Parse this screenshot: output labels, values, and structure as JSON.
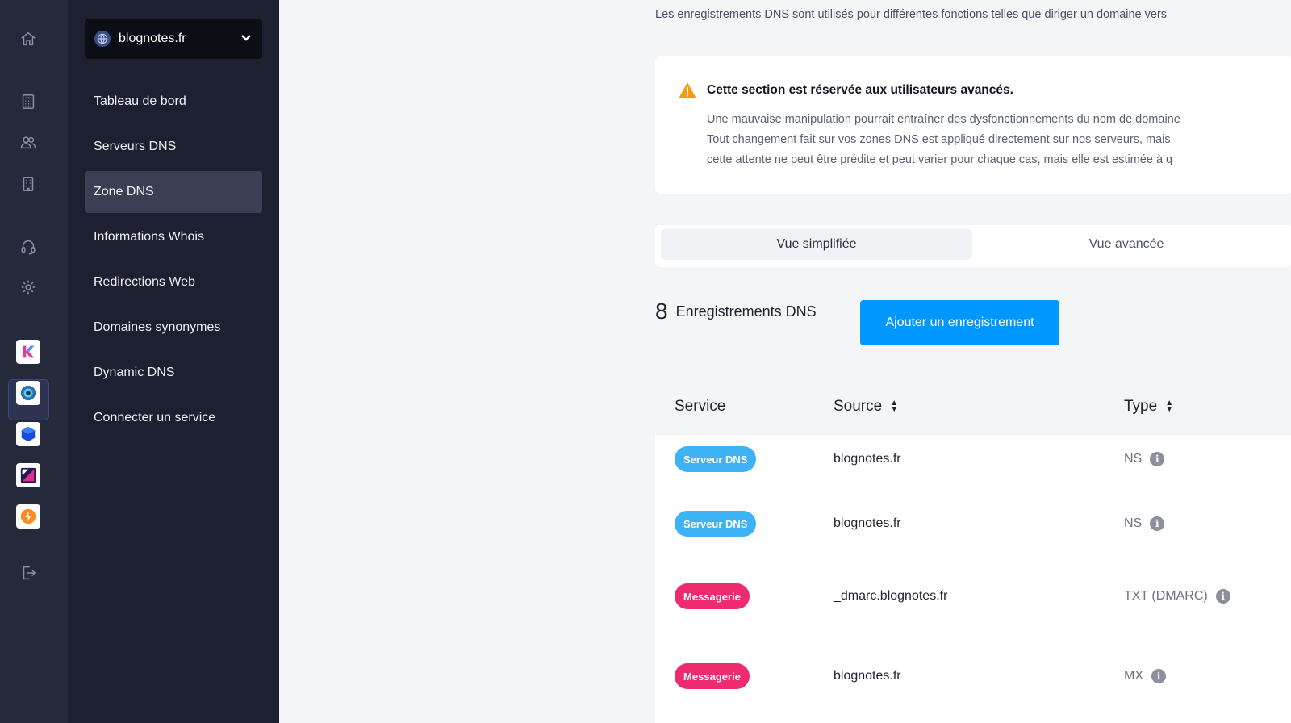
{
  "sidebar": {
    "domain": "blognotes.fr",
    "items": [
      {
        "label": "Tableau de bord"
      },
      {
        "label": "Serveurs DNS"
      },
      {
        "label": "Zone DNS"
      },
      {
        "label": "Informations Whois"
      },
      {
        "label": "Redirections Web"
      },
      {
        "label": "Domaines synonymes"
      },
      {
        "label": "Dynamic DNS"
      },
      {
        "label": "Connecter un service"
      }
    ],
    "active_item": "Zone DNS"
  },
  "rail": {
    "icons": [
      "home-icon",
      "calculator-icon",
      "users-icon",
      "building-icon",
      "headset-icon",
      "settings-icon",
      "logout-icon"
    ],
    "apps": [
      "kchat-app",
      "domains-app",
      "kdrive-app",
      "mail-app",
      "swisstransfer-app"
    ]
  },
  "main": {
    "intro": "Les enregistrements DNS sont utilisés pour différentes fonctions telles que diriger un domaine vers",
    "warning": {
      "title": "Cette section est réservée aux utilisateurs avancés.",
      "lines": [
        "Une mauvaise manipulation pourrait entraîner des dysfonctionnements du nom de domaine",
        "Tout changement fait sur vos zones DNS est appliqué directement sur nos serveurs, mais",
        "cette attente ne peut être prédite et peut varier pour chaque cas, mais elle est estimée à q"
      ]
    },
    "views": {
      "simple": "Vue simplifiée",
      "advanced": "Vue avancée"
    },
    "count": "8",
    "count_label": "Enregistrements DNS",
    "add_button": "Ajouter un enregistrement",
    "table": {
      "headers": {
        "service": "Service",
        "source": "Source",
        "type": "Type"
      },
      "rows": [
        {
          "service": "Serveur DNS",
          "source": "blognotes.fr",
          "type": "NS"
        },
        {
          "service": "Serveur DNS",
          "source": "blognotes.fr",
          "type": "NS"
        },
        {
          "service": "Messagerie",
          "source": "_dmarc.blognotes.fr",
          "type": "TXT (DMARC)"
        },
        {
          "service": "Messagerie",
          "source": "blognotes.fr",
          "type": "MX"
        }
      ]
    }
  },
  "colors": {
    "primary": "#0098ff",
    "badge_dns": "#3db3f5",
    "badge_mail": "#ee2b6e",
    "sidebar_bg": "#1c2030",
    "rail_bg": "#252a3b"
  }
}
